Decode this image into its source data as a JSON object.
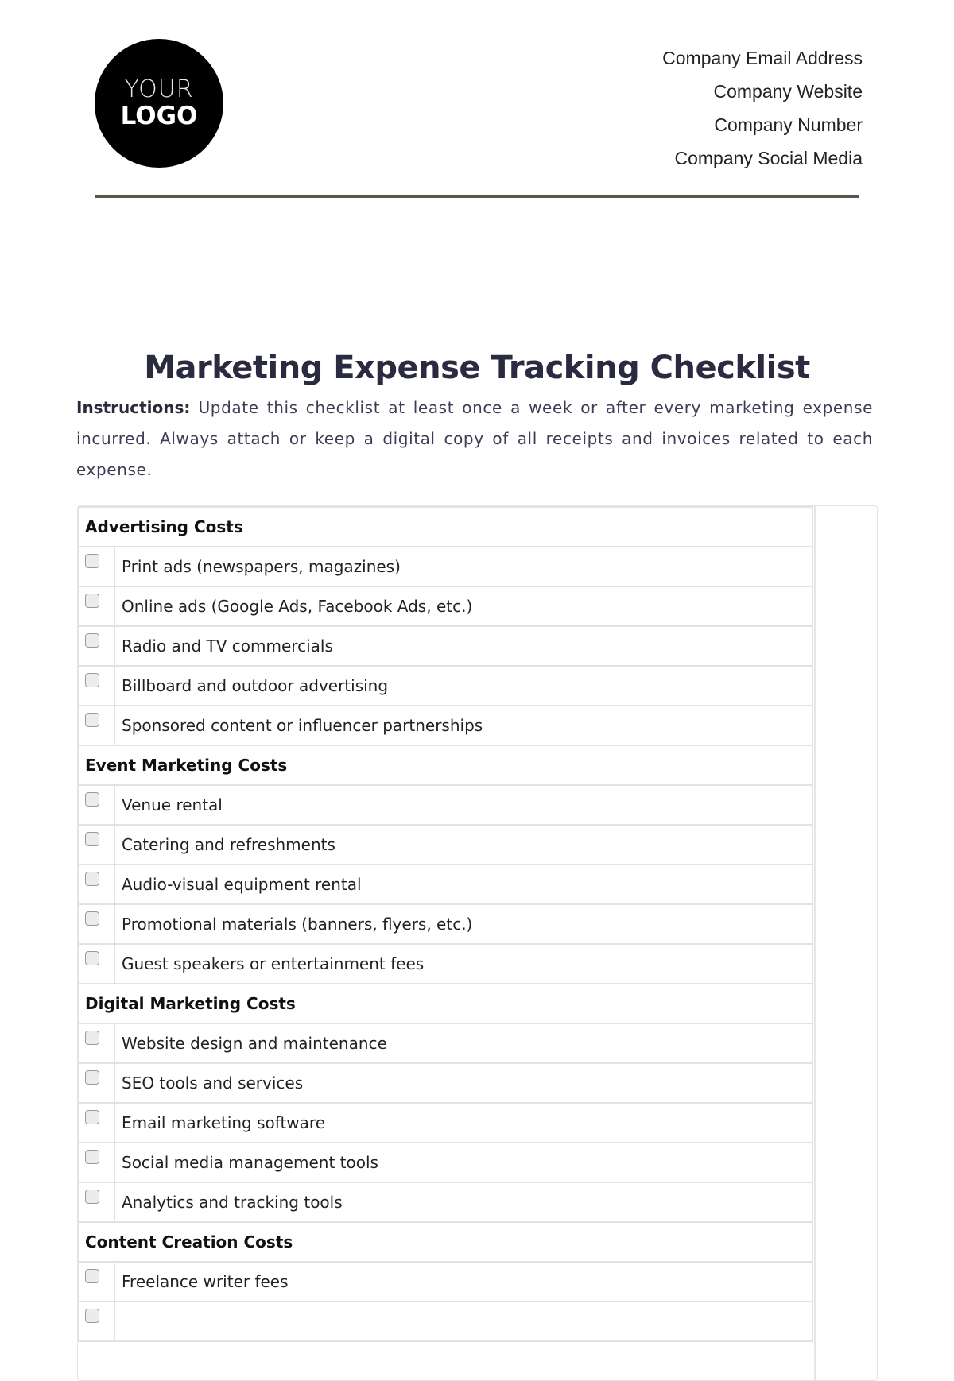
{
  "header": {
    "logo": {
      "line1": "YOUR",
      "line2": "LOGO"
    },
    "contact": [
      "Company Email Address",
      "Company Website",
      "Company Number",
      "Company Social Media"
    ]
  },
  "title": "Marketing Expense Tracking Checklist",
  "instructions": {
    "label": "Instructions:",
    "text": " Update this checklist at least once a week or after every marketing expense incurred. Always attach or keep a digital copy of all receipts and invoices related to each expense."
  },
  "sections": [
    {
      "title": "Advertising Costs",
      "items": [
        {
          "label": "Print ads (newspapers, magazines)",
          "checked": false
        },
        {
          "label": "Online ads (Google Ads, Facebook Ads, etc.)",
          "checked": false
        },
        {
          "label": "Radio and TV commercials",
          "checked": false
        },
        {
          "label": "Billboard and outdoor advertising",
          "checked": false
        },
        {
          "label": "Sponsored content or influencer partnerships",
          "checked": false
        }
      ]
    },
    {
      "title": "Event Marketing Costs",
      "items": [
        {
          "label": "Venue rental",
          "checked": false
        },
        {
          "label": "Catering and refreshments",
          "checked": false
        },
        {
          "label": "Audio-visual equipment rental",
          "checked": false
        },
        {
          "label": "Promotional materials (banners, flyers, etc.)",
          "checked": false
        },
        {
          "label": "Guest speakers or entertainment fees",
          "checked": false
        }
      ]
    },
    {
      "title": "Digital Marketing Costs",
      "items": [
        {
          "label": "Website design and maintenance",
          "checked": false
        },
        {
          "label": "SEO tools and services",
          "checked": false
        },
        {
          "label": "Email marketing software",
          "checked": false
        },
        {
          "label": "Social media management tools",
          "checked": false
        },
        {
          "label": "Analytics and tracking tools",
          "checked": false
        }
      ]
    },
    {
      "title": "Content Creation Costs",
      "items": [
        {
          "label": "Freelance writer fees",
          "checked": false
        },
        {
          "label": "",
          "checked": false
        }
      ]
    }
  ]
}
